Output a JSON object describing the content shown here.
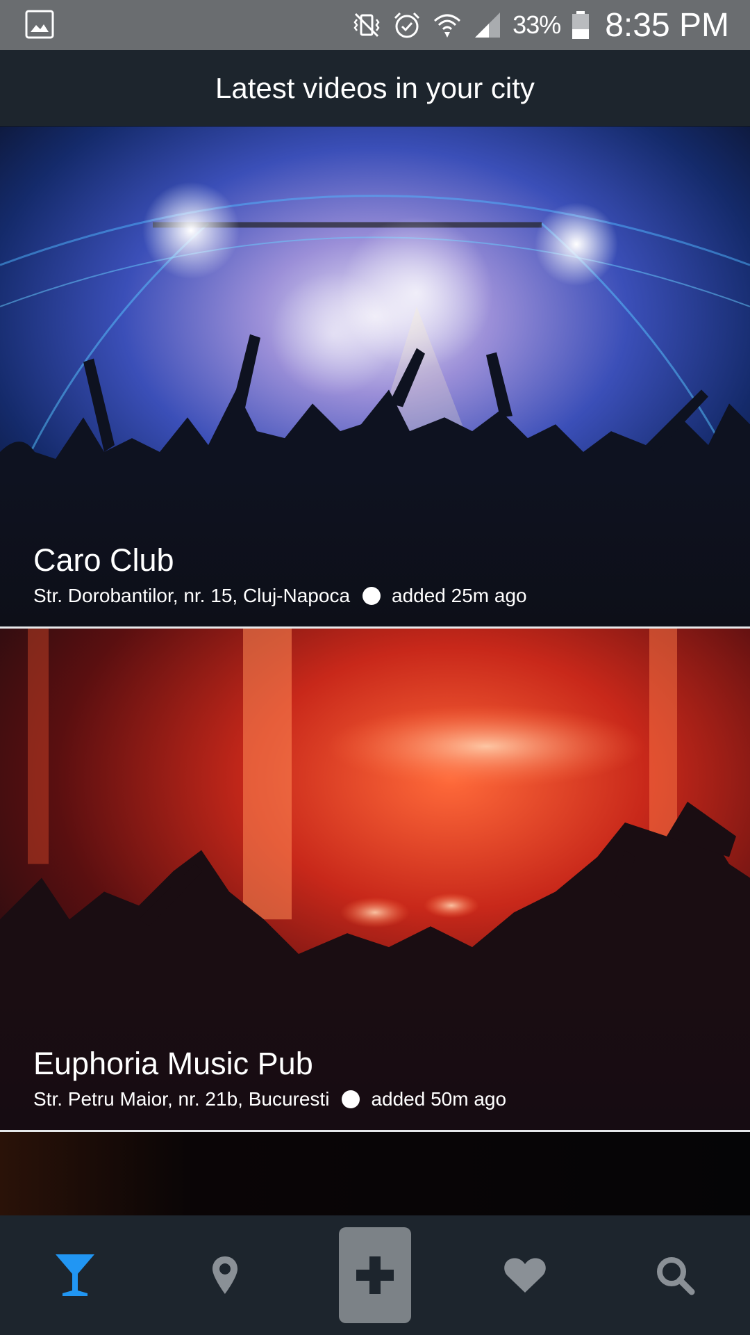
{
  "status_bar": {
    "battery_percent": "33%",
    "time": "8:35 PM",
    "icons": [
      "gallery-icon",
      "vibrate-icon",
      "alarm-icon",
      "wifi-icon",
      "signal-icon",
      "battery-icon"
    ]
  },
  "header": {
    "title": "Latest videos in your city"
  },
  "feed": [
    {
      "venue": "Caro Club",
      "address": "Str. Dorobantilor, nr. 15, Cluj-Napoca",
      "added": "added 25m ago"
    },
    {
      "venue": "Euphoria Music Pub",
      "address": "Str. Petru Maior, nr. 21b, Bucuresti",
      "added": "added 50m ago"
    }
  ],
  "bottom_nav": {
    "items": [
      "cocktail-icon",
      "location-pin-icon",
      "add-icon",
      "heart-icon",
      "search-icon"
    ],
    "active_item": "cocktail-icon"
  },
  "colors": {
    "status_bar": "#6a6d70",
    "header_bg": "#1d252d",
    "nav_bg": "#1d252d",
    "accent": "#2196f3",
    "inactive_icon": "#8a9096",
    "add_button_bg": "#7c8287"
  }
}
